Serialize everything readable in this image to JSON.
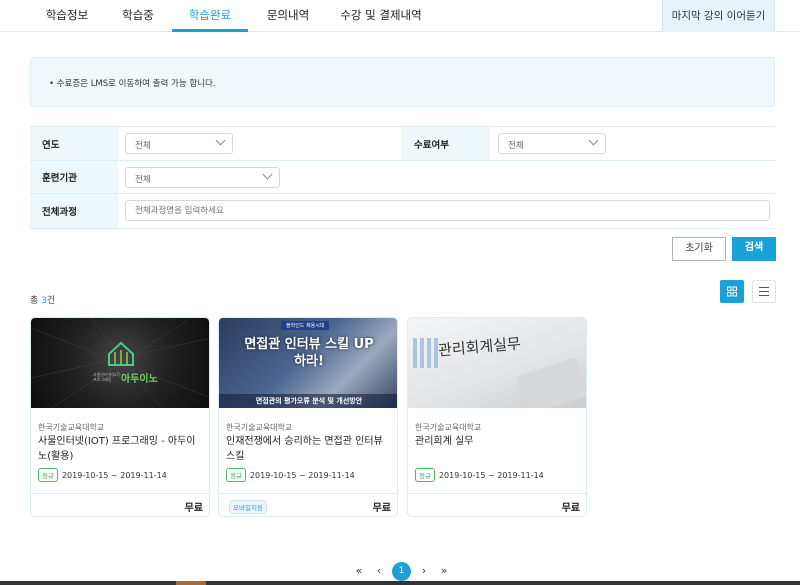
{
  "tabs": [
    {
      "label": "학습정보"
    },
    {
      "label": "학습중"
    },
    {
      "label": "학습완료",
      "active": true
    },
    {
      "label": "문의내역"
    },
    {
      "label": "수강 및 결제내역"
    }
  ],
  "resume_label": "마지막 강의 이어듣기",
  "notice": "• 수료증은 LMS로 이동하여 출력 가능 합니다.",
  "filters": {
    "year": {
      "label": "연도",
      "value": "전체"
    },
    "completion": {
      "label": "수료여부",
      "value": "전체"
    },
    "institution": {
      "label": "훈련기관",
      "value": "전체"
    },
    "course": {
      "label": "전체과정",
      "placeholder": "전체과정명을 입력하세요"
    }
  },
  "buttons": {
    "reset": "초기화",
    "search": "검색"
  },
  "total": {
    "prefix": "총 ",
    "count": "3",
    "suffix": "건"
  },
  "view": {
    "active": "grid"
  },
  "cards": [
    {
      "thumb_text": "아두이노",
      "thumb_sub": "사물인터넷(IoT) 프로그래밍",
      "institution": "한국기술교육대학교",
      "title": "사물인터넷(IOT) 프로그래밍 - 아두이노(활용)",
      "badge": "정규",
      "period": "2019-10-15 ~ 2019-11-14",
      "mobile": "",
      "price": "무료"
    },
    {
      "thumb_text": "면접관 인터뷰 스킬 UP 하라!",
      "thumb_sub": "면접관의 평가오류 분석 및 개선방안",
      "thumb_top": "블라인드 채용시대",
      "institution": "한국기술교육대학교",
      "title": "인재전쟁에서 승리하는 면접관 인터뷰 스킬",
      "badge": "정규",
      "period": "2019-10-15 ~ 2019-11-14",
      "mobile": "모바일지원",
      "price": "무료"
    },
    {
      "thumb_text": "관리회계실무",
      "institution": "한국기술교육대학교",
      "title": "관리회계 실무",
      "badge": "정규",
      "period": "2019-10-15 ~ 2019-11-14",
      "mobile": "",
      "price": "무료"
    }
  ],
  "pagination": {
    "first": "«",
    "prev": "‹",
    "current": "1",
    "next": "›",
    "last": "»"
  },
  "colors": {
    "accent": "#1ba0d8",
    "badge_green": "#3aa65a"
  }
}
